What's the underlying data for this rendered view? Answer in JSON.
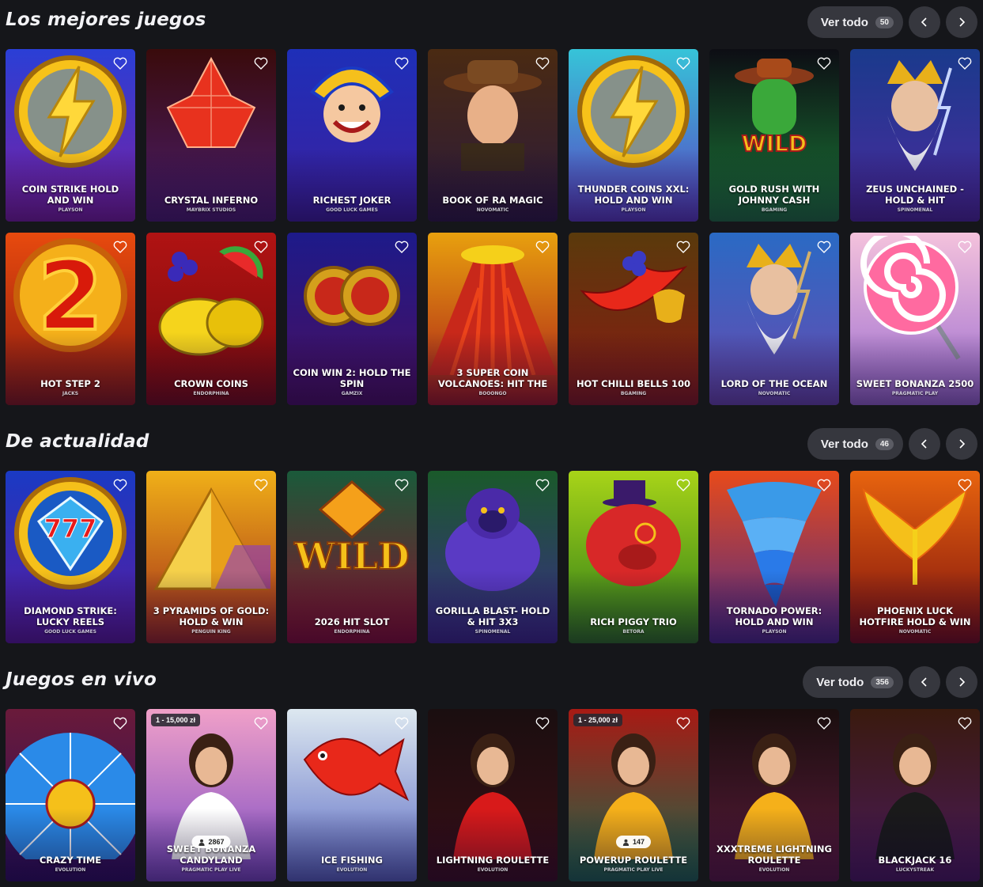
{
  "sections": [
    {
      "title": "Los mejores juegos",
      "ver_todo": "Ver todo",
      "count": "50",
      "rows": [
        [
          {
            "name": "Coin Strike Hold and Win",
            "provider": "Playson",
            "bg": [
              "#2a3fd6",
              "#7b1fa2"
            ],
            "accent": "#f7c21a",
            "emblem": "bolt-coin"
          },
          {
            "name": "Crystal Inferno",
            "provider": "Maybrix Studios",
            "bg": [
              "#3a0b0b",
              "#4a1d6e"
            ],
            "accent": "#e8321e",
            "emblem": "crystal"
          },
          {
            "name": "Richest Joker",
            "provider": "Good Luck Games",
            "bg": [
              "#1e2fb8",
              "#3c1f9e"
            ],
            "accent": "#f5c01c",
            "emblem": "joker"
          },
          {
            "name": "Book of Ra Magic",
            "provider": "Novomatic",
            "bg": [
              "#4a2a12",
              "#2b1a3b"
            ],
            "accent": "#c97c3a",
            "emblem": "explorer"
          },
          {
            "name": "Thunder Coins XXL: Hold and Win",
            "provider": "Playson",
            "bg": [
              "#36c4d8",
              "#5b3fc4"
            ],
            "accent": "#f7c21a",
            "emblem": "bolt-coin"
          },
          {
            "name": "Gold Rush with Johnny Cash",
            "provider": "BGaming",
            "bg": [
              "#0d0d14",
              "#1a7a36"
            ],
            "accent": "#e84a1a",
            "emblem": "cactus"
          },
          {
            "name": "Zeus Unchained - Hold & Hit",
            "provider": "Spinomenal",
            "bg": [
              "#1a3a8c",
              "#4b2a9e"
            ],
            "accent": "#c8d6ff",
            "emblem": "zeus"
          }
        ],
        [
          {
            "name": "Hot Step 2",
            "provider": "Jacks",
            "bg": [
              "#e84a0e",
              "#8a1a0e"
            ],
            "accent": "#f7a21a",
            "emblem": "two"
          },
          {
            "name": "Crown Coins",
            "provider": "Endorphina",
            "bg": [
              "#b01313",
              "#7a0b0b"
            ],
            "accent": "#f5d41c",
            "emblem": "fruit"
          },
          {
            "name": "Coin Win 2: Hold the Spin",
            "provider": "Gamzix",
            "bg": [
              "#1d1a8a",
              "#4a0f5e"
            ],
            "accent": "#d4a01c",
            "emblem": "coins"
          },
          {
            "name": "3 Super Coin Volcanoes: Hit the",
            "provider": "Booongo",
            "bg": [
              "#e8a00e",
              "#a81a1a"
            ],
            "accent": "#f54a1a",
            "emblem": "volcano"
          },
          {
            "name": "Hot Chilli Bells 100",
            "provider": "BGaming",
            "bg": [
              "#5a3a0c",
              "#8a1a12"
            ],
            "accent": "#e8281a",
            "emblem": "chilli"
          },
          {
            "name": "Lord of the Ocean",
            "provider": "Novomatic",
            "bg": [
              "#2a6ac4",
              "#6a4ab0"
            ],
            "accent": "#d4b06a",
            "emblem": "zeus"
          },
          {
            "name": "Sweet Bonanza 2500",
            "provider": "Pragmatic Play",
            "bg": [
              "#f4c2dc",
              "#9a6ad0"
            ],
            "accent": "#e8284a",
            "emblem": "lollipop"
          }
        ]
      ]
    },
    {
      "title": "De actualidad",
      "ver_todo": "Ver todo",
      "count": "46",
      "rows": [
        [
          {
            "name": "Diamond Strike: Lucky Reels",
            "provider": "Good Luck Games",
            "bg": [
              "#1a3ac4",
              "#5a1a9e"
            ],
            "accent": "#3ab0f0",
            "emblem": "diamond"
          },
          {
            "name": "3 Pyramids of Gold: Hold & Win",
            "provider": "Penguin King",
            "bg": [
              "#f0b018",
              "#a0281a"
            ],
            "accent": "#f5d04a",
            "emblem": "pyramid"
          },
          {
            "name": "2026 Hit Slot",
            "provider": "Endorphina",
            "bg": [
              "#1a5a3a",
              "#8a0e2a"
            ],
            "accent": "#f5a01a",
            "emblem": "wild"
          },
          {
            "name": "Gorilla Blast- Hold & Hit 3x3",
            "provider": "Spinomenal",
            "bg": [
              "#1a5a2a",
              "#3a2a8a"
            ],
            "accent": "#5a3ac4",
            "emblem": "gorilla"
          },
          {
            "name": "Rich Piggy Trio",
            "provider": "Betora",
            "bg": [
              "#a8d418",
              "#2a7a18"
            ],
            "accent": "#d82828",
            "emblem": "pig"
          },
          {
            "name": "Tornado Power: Hold and Win",
            "provider": "Playson",
            "bg": [
              "#e84a1a",
              "#4a2a8a"
            ],
            "accent": "#3a9ae8",
            "emblem": "tornado"
          },
          {
            "name": "Phoenix Luck Hotfire Hold & Win",
            "provider": "Novomatic",
            "bg": [
              "#e8640e",
              "#7a0e0e"
            ],
            "accent": "#f5c01a",
            "emblem": "phoenix"
          }
        ]
      ]
    },
    {
      "title": "Juegos en vivo",
      "ver_todo": "Ver todo",
      "count": "356",
      "rows": [
        [
          {
            "name": "Crazy Time",
            "provider": "Evolution",
            "bg": [
              "#6a1a3a",
              "#2a0e5a"
            ],
            "accent": "#f5c01a",
            "emblem": "wheel"
          },
          {
            "name": "Sweet Bonanza Candyland",
            "provider": "Pragmatic Play Live",
            "bg": [
              "#f0a0c8",
              "#7a4ac4"
            ],
            "accent": "#ffffff",
            "emblem": "host",
            "bet": "1 - 15,000 zł",
            "players": "2867"
          },
          {
            "name": "Ice Fishing",
            "provider": "Evolution",
            "bg": [
              "#dde8f0",
              "#5a6ac4"
            ],
            "accent": "#e8281a",
            "emblem": "fish"
          },
          {
            "name": "Lightning Roulette",
            "provider": "Evolution",
            "bg": [
              "#1a0e10",
              "#3a0e14"
            ],
            "accent": "#d81a1a",
            "emblem": "host"
          },
          {
            "name": "PowerUP Roulette",
            "provider": "Pragmatic Play Live",
            "bg": [
              "#a81a14",
              "#1a6a4a"
            ],
            "accent": "#f5b01a",
            "emblem": "host",
            "bet": "1 - 25,000 zł",
            "players": "147"
          },
          {
            "name": "XXXtreme Lightning Roulette",
            "provider": "Evolution",
            "bg": [
              "#1a0e0e",
              "#5a1a3a"
            ],
            "accent": "#f5b01a",
            "emblem": "host"
          },
          {
            "name": "Blackjack 16",
            "provider": "Luckystreak",
            "bg": [
              "#3a1a0e",
              "#4a1a5a"
            ],
            "accent": "#1a1a1a",
            "emblem": "host"
          }
        ]
      ]
    }
  ]
}
